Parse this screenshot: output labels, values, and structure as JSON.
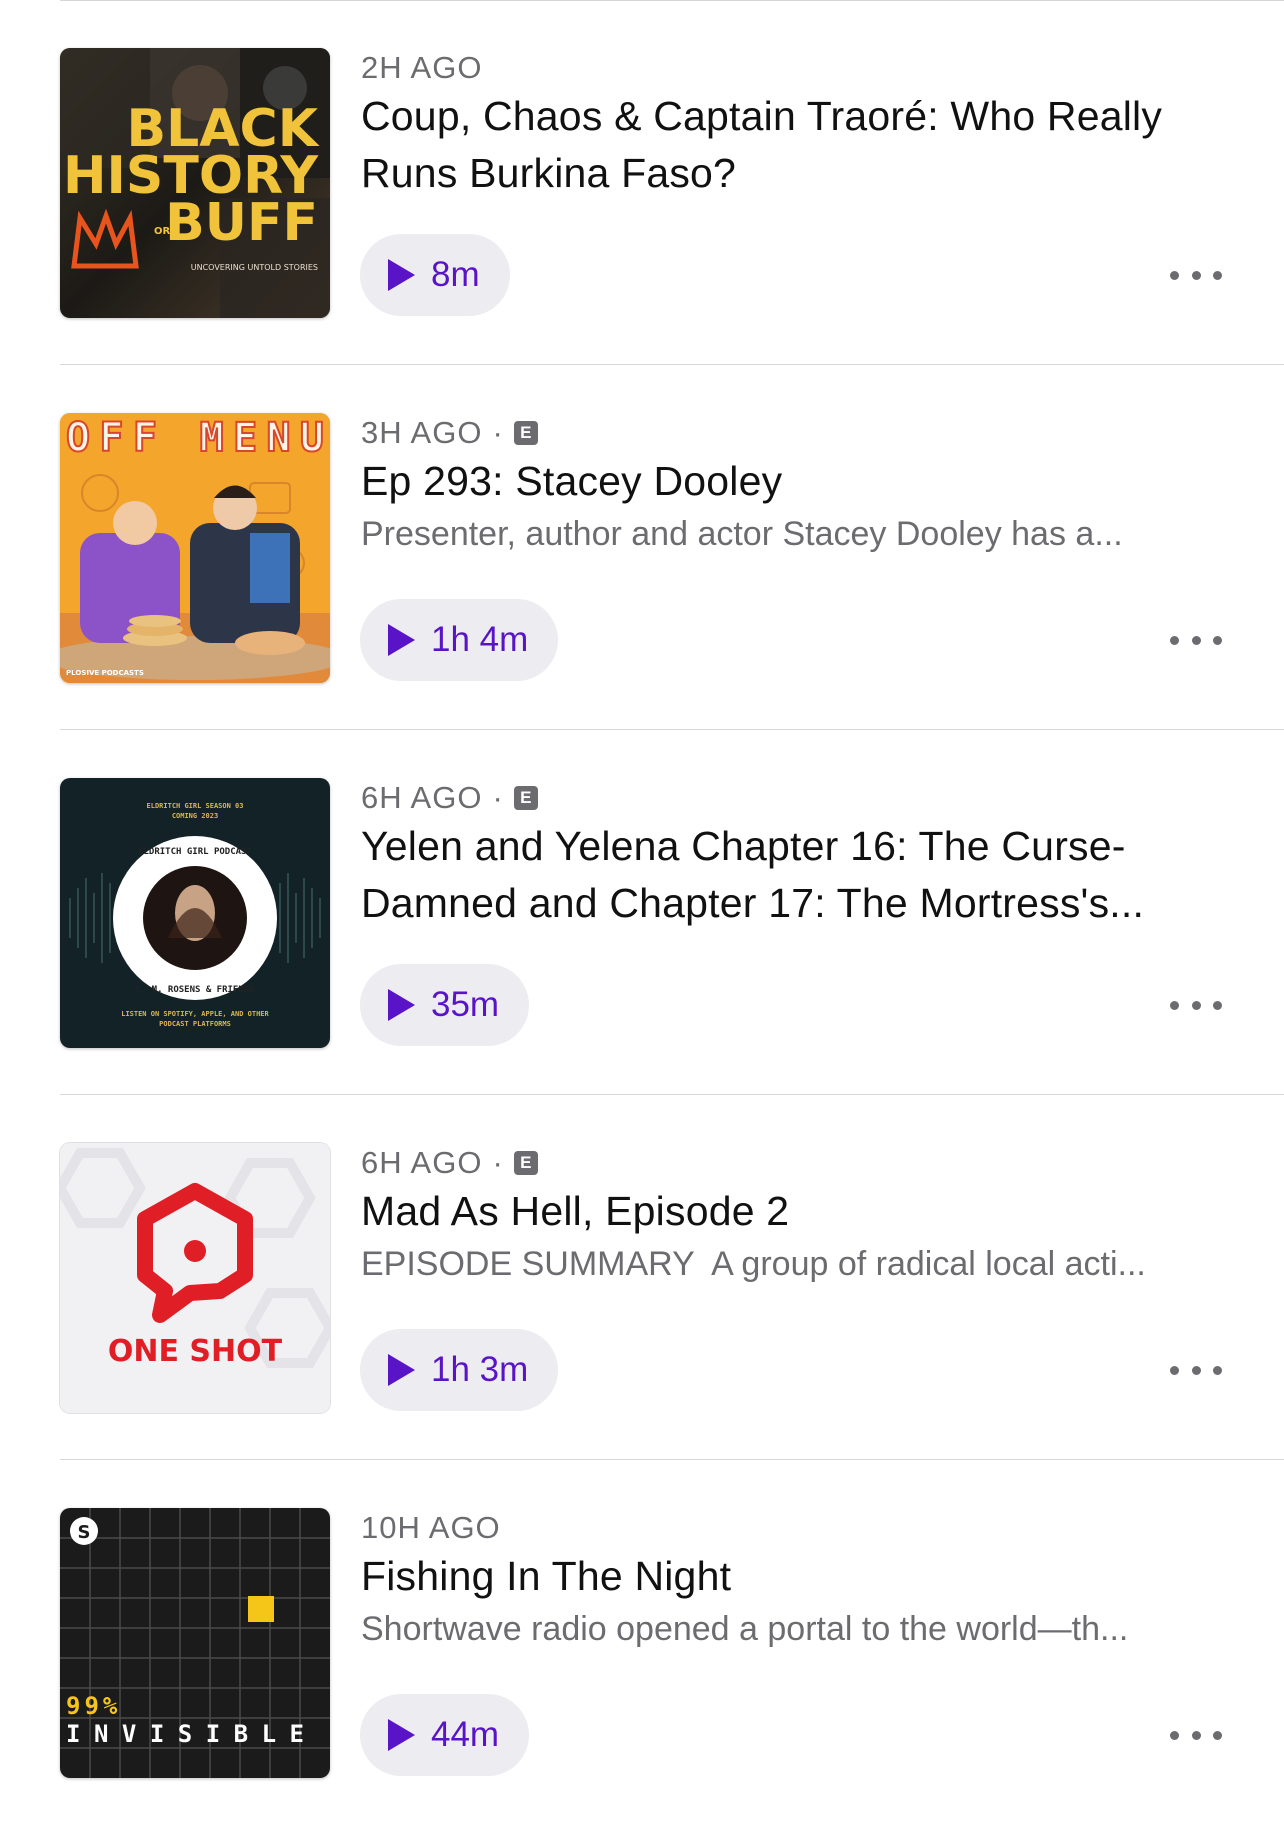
{
  "episodes": [
    {
      "time": "2H AGO",
      "explicit": false,
      "title": "Coup, Chaos & Captain Traoré: Who Really Runs Burkina Faso?",
      "description": "",
      "duration": "8m",
      "art": {
        "name": "black-history-buff-artwork",
        "lines": [
          "BLACK",
          "HISTORY",
          "BUFF"
        ],
        "small_tag": "OR",
        "tagline": "UNCOVERING UNTOLD STORIES"
      }
    },
    {
      "time": "3H AGO",
      "explicit": true,
      "explicit_label": "E",
      "title": "Ep 293: Stacey Dooley",
      "description": "Presenter, author and actor Stacey Dooley has a...",
      "duration": "1h 4m",
      "art": {
        "name": "off-menu-artwork",
        "lines": [
          "OFF MENU"
        ],
        "tagline": "PLOSIVE PODCASTS"
      }
    },
    {
      "time": "6H AGO",
      "explicit": true,
      "explicit_label": "E",
      "title": "Yelen and Yelena Chapter 16: The Curse-Damned and Chapter 17: The Mortress's...",
      "description": "",
      "duration": "35m",
      "art": {
        "name": "eldritch-girl-podcast-artwork",
        "lines": [
          "ELDRITCH GIRL SEASON 03",
          "COMING 2023",
          "ELDRITCH GIRL PODCAST",
          "C. M. ROSENS & FRIENDS",
          "LISTEN ON SPOTIFY, APPLE, AND OTHER",
          "PODCAST PLATFORMS"
        ]
      }
    },
    {
      "time": "6H AGO",
      "explicit": true,
      "explicit_label": "E",
      "title": "Mad As Hell, Episode 2",
      "description": "EPISODE SUMMARY  A group of radical local acti...",
      "duration": "1h 3m",
      "art": {
        "name": "one-shot-artwork",
        "lines": [
          "ONE SHOT"
        ]
      }
    },
    {
      "time": "10H AGO",
      "explicit": false,
      "title": "Fishing In The Night",
      "description": "Shortwave radio opened a portal to the world—th...",
      "duration": "44m",
      "art": {
        "name": "99-percent-invisible-artwork",
        "lines": [
          "99%",
          "INVISIBLE"
        ],
        "badge": "S"
      }
    }
  ],
  "colors": {
    "accent": "#5a14c8",
    "secondary_text": "#6c6c70",
    "pill_bg": "#ececf1"
  }
}
